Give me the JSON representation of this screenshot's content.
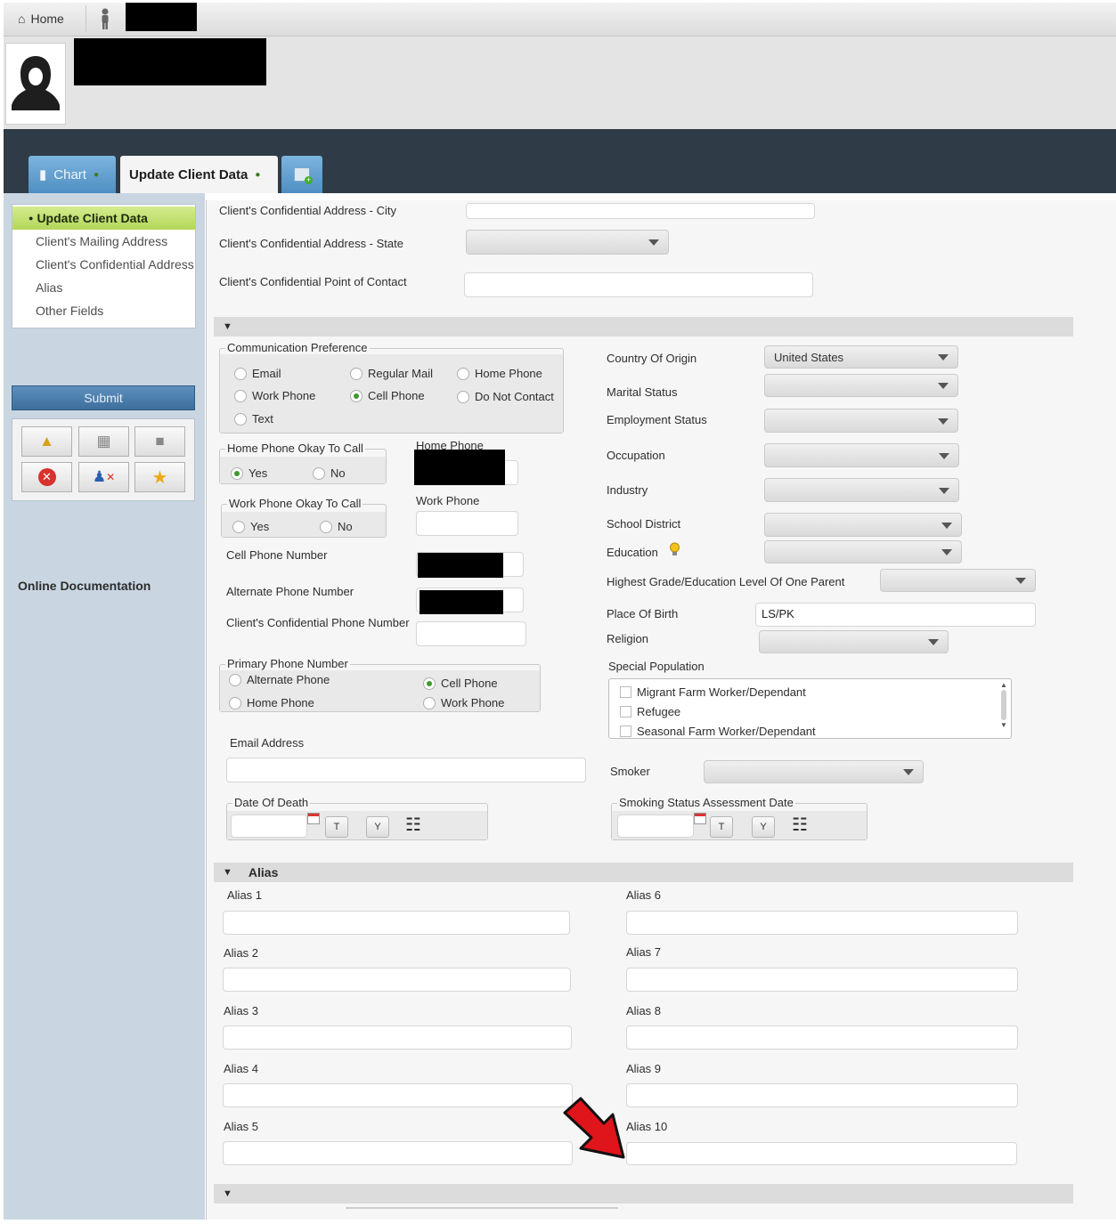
{
  "topbar": {
    "home_label": "Home"
  },
  "tabs": {
    "chart": "Chart",
    "update": "Update Client Data"
  },
  "sidebar": {
    "nav": [
      "Update Client Data",
      "Client's Mailing Address",
      "Client's Confidential Address",
      "Alias",
      "Other Fields"
    ],
    "submit": "Submit",
    "online_doc": "Online Documentation"
  },
  "confidential": {
    "city": "Client's Confidential Address - City",
    "state": "Client's Confidential Address - State",
    "contact": "Client's Confidential Point of Contact"
  },
  "comm": {
    "legend": "Communication Preference",
    "options": [
      "Email",
      "Regular Mail",
      "Home Phone",
      "Work Phone",
      "Cell Phone",
      "Do Not Contact",
      "Text"
    ],
    "selected": "Cell Phone"
  },
  "home_ok": {
    "legend": "Home Phone Okay To Call",
    "yes": "Yes",
    "no": "No",
    "selected": "Yes"
  },
  "work_ok": {
    "legend": "Work Phone Okay To Call",
    "yes": "Yes",
    "no": "No",
    "selected": ""
  },
  "phones": {
    "home": "Home Phone",
    "work": "Work Phone",
    "cell": "Cell Phone Number",
    "alternate": "Alternate Phone Number",
    "confidential": "Client's Confidential Phone Number"
  },
  "primary": {
    "legend": "Primary Phone Number",
    "options": [
      "Alternate Phone",
      "Cell Phone",
      "Home Phone",
      "Work Phone"
    ],
    "selected": "Cell Phone"
  },
  "email": {
    "label": "Email Address"
  },
  "death": {
    "legend": "Date Of Death",
    "t": "T",
    "y": "Y"
  },
  "right": {
    "country": {
      "label": "Country Of Origin",
      "value": "United States"
    },
    "marital": "Marital Status",
    "employment": "Employment Status",
    "occupation": "Occupation",
    "industry": "Industry",
    "school": "School District",
    "education": "Education",
    "highest": "Highest Grade/Education Level Of One Parent",
    "birth": {
      "label": "Place Of Birth",
      "value": "LS/PK"
    },
    "religion": "Religion",
    "special": {
      "label": "Special Population",
      "items": [
        "Migrant Farm Worker/Dependant",
        "Refugee",
        "Seasonal Farm Worker/Dependant"
      ]
    },
    "smoker": "Smoker",
    "smoking_date": {
      "legend": "Smoking Status Assessment Date",
      "t": "T",
      "y": "Y"
    }
  },
  "alias": {
    "title": "Alias",
    "labels": [
      "Alias 1",
      "Alias 2",
      "Alias 3",
      "Alias 4",
      "Alias 5",
      "Alias 6",
      "Alias 7",
      "Alias 8",
      "Alias 9",
      "Alias 10"
    ]
  },
  "colors": {
    "accent_green": "#b3d65a",
    "dark_band": "#2f3b46",
    "tab_blue": "#4f8fc2",
    "submit_blue": "#3e6f9c",
    "arrow_red": "#e0141b"
  },
  "icons": [
    "home-icon",
    "person-icon",
    "avatar-icon",
    "chart-icon",
    "pin-icon",
    "add-tab-icon",
    "lightbulb-icon",
    "calendar-icon",
    "red-arrow-icon"
  ]
}
